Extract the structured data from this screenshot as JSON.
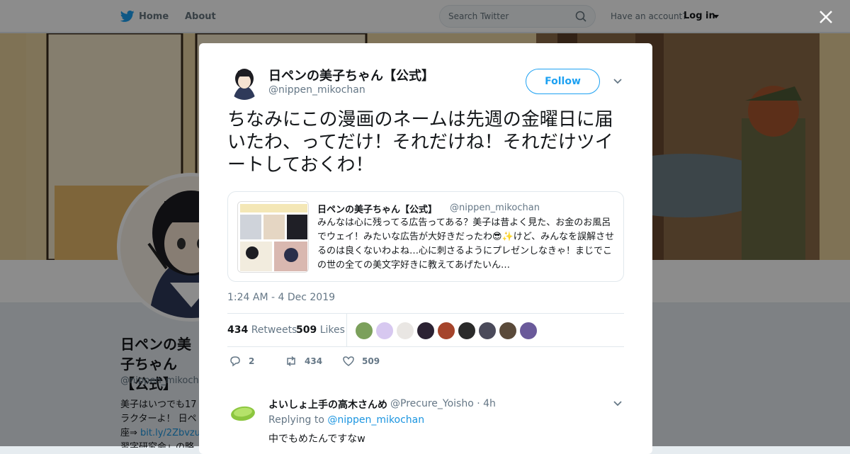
{
  "nav": {
    "home_label": "Home",
    "about_label": "About",
    "search_placeholder": "Search Twitter",
    "have_account": "Have an account?",
    "login_label": "Log in"
  },
  "profile": {
    "name": "日ペンの美子ちゃん【公式】",
    "handle": "@nippen_mikochan",
    "bio_lines": [
      "美子はいつでも17",
      "ラクターよ！ 日ペ",
      "座⇒ ",
      "bit.ly/2Zbvzu",
      "習字研究会」の略"
    ]
  },
  "tweet": {
    "author_name": "日ペンの美子ちゃん【公式】",
    "author_handle": "@nippen_mikochan",
    "follow_label": "Follow",
    "text": "ちなみにこの漫画のネームは先週の金曜日に届いたわ、ってだけ！それだけね！それだけツイートしておくわ！",
    "timestamp": "1:24 AM - 4 Dec 2019",
    "retweets_count": "434",
    "retweets_label": "Retweets",
    "likes_count": "509",
    "likes_label": "Likes",
    "liker_colors": [
      "#7ba05b",
      "#d7c8f0",
      "#e9e6e3",
      "#2b2233",
      "#a5442b",
      "#2a2a2a",
      "#4a4a5a",
      "#5a4a3a",
      "#6a5a9a"
    ],
    "actions": {
      "replies": "2",
      "retweets": "434",
      "likes": "509"
    }
  },
  "quoted": {
    "author_name": "日ペンの美子ちゃん【公式】",
    "author_handle": "@nippen_mikochan",
    "text": "みんなは心に残ってる広告ってある？美子は昔よく見た、お金のお風呂でウェイ！みたいな広告が大好きだったわ😎✨けど、みんなを誤解させるのは良くないわよね…心に刺さるようにプレゼンしなきゃ！まじでこの世の全ての美文字好きに教えてあげたいん…"
  },
  "reply": {
    "author_name": "よいしょ上手の高木さんめ",
    "author_handle": "@Precure_Yoisho · 4h",
    "replying_prefix": "Replying to ",
    "replying_to": "@nippen_mikochan",
    "text": "中でもめたんですなw"
  },
  "colors": {
    "accent": "#1da1f2",
    "link": "#1b95e0",
    "text": "#14171a",
    "muted": "#657786"
  }
}
